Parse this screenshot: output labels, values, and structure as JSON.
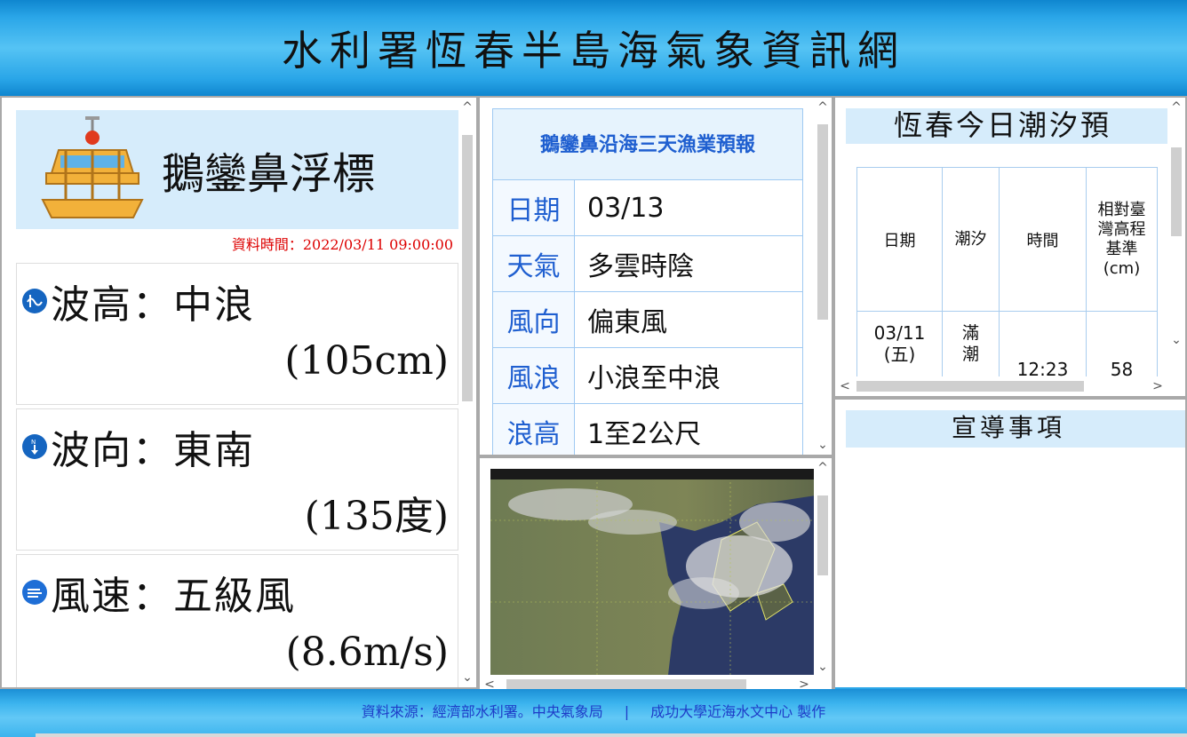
{
  "header": {
    "title": "水利署恆春半島海氣象資訊網"
  },
  "buoy": {
    "title": "鵝鑾鼻浮標",
    "data_time": "資料時間：2022/03/11 09:00:00",
    "metrics": [
      {
        "icon": "wave-height-icon",
        "label": "波高：中浪",
        "value": "(105cm)"
      },
      {
        "icon": "wave-direction-icon",
        "label": "波向：東南",
        "value": "(135度)"
      },
      {
        "icon": "wind-speed-icon",
        "label": "風速：五級風",
        "value": "(8.6m/s)"
      }
    ]
  },
  "fishery": {
    "title": "鵝鑾鼻沿海三天漁業預報",
    "rows": [
      {
        "key": "日期",
        "value": "03/13"
      },
      {
        "key": "天氣",
        "value": "多雲時陰"
      },
      {
        "key": "風向",
        "value": "偏東風"
      },
      {
        "key": "風浪",
        "value": "小浪至中浪"
      },
      {
        "key": "浪高",
        "value": "1至2公尺"
      }
    ]
  },
  "tide": {
    "title": "恆春今日潮汐預",
    "headers": [
      "日期",
      "潮汐",
      "時間",
      "相對臺灣高程基準(cm)"
    ],
    "rows": [
      {
        "date": "03/11",
        "weekday": "(五)",
        "tide": "滿潮",
        "time": "12:23",
        "height": "58"
      }
    ]
  },
  "notice": {
    "title": "宣導事項"
  },
  "footer": {
    "source": "資料來源：經濟部水利署。中央氣象局",
    "separator": "|",
    "credit": "成功大學近海水文中心 製作"
  },
  "scroll_glyphs": {
    "up": "^",
    "down": "⌄",
    "left": "<",
    "right": ">"
  },
  "colors": {
    "header_blue": "#2aa6e8",
    "panel_title_bg": "#d6ecfb",
    "forecast_key_blue": "#1f5fd0",
    "time_red": "#dd0000",
    "footer_text": "#1e3cc8"
  }
}
